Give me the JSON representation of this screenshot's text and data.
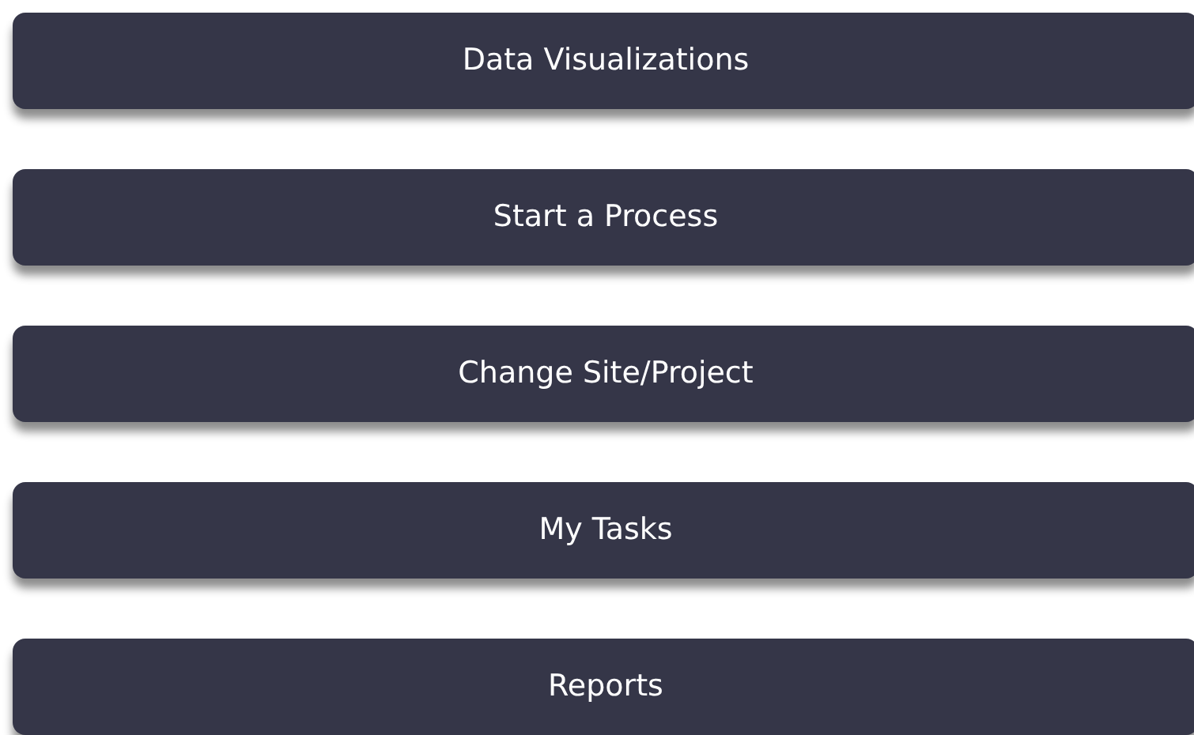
{
  "buttons": [
    {
      "label": "Data Visualizations"
    },
    {
      "label": "Start a Process"
    },
    {
      "label": "Change Site/Project"
    },
    {
      "label": "My Tasks"
    },
    {
      "label": "Reports"
    }
  ]
}
